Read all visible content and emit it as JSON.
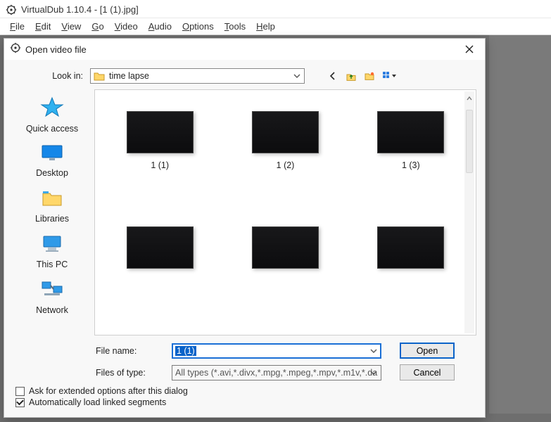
{
  "app": {
    "title": "VirtualDub 1.10.4 - [1 (1).jpg]"
  },
  "menubar": {
    "items": [
      {
        "label": "File",
        "accel": "F"
      },
      {
        "label": "Edit",
        "accel": "E"
      },
      {
        "label": "View",
        "accel": "V"
      },
      {
        "label": "Go",
        "accel": "G"
      },
      {
        "label": "Video",
        "accel": "V"
      },
      {
        "label": "Audio",
        "accel": "A"
      },
      {
        "label": "Options",
        "accel": "O"
      },
      {
        "label": "Tools",
        "accel": "T"
      },
      {
        "label": "Help",
        "accel": "H"
      }
    ]
  },
  "dialog": {
    "title": "Open video file",
    "lookin_label": "Look in:",
    "lookin_value": "time lapse",
    "places": [
      {
        "label": "Quick access"
      },
      {
        "label": "Desktop"
      },
      {
        "label": "Libraries"
      },
      {
        "label": "This PC"
      },
      {
        "label": "Network"
      }
    ],
    "files": [
      {
        "name": "1 (1)"
      },
      {
        "name": "1 (2)"
      },
      {
        "name": "1 (3)"
      },
      {
        "name": ""
      },
      {
        "name": ""
      },
      {
        "name": ""
      }
    ],
    "filename_label": "File name:",
    "filename_value": "1 (1)",
    "filetype_label": "Files of type:",
    "filetype_value": "All types (*.avi,*.divx,*.mpg,*.mpeg,*.mpv,*.m1v,*.da",
    "open_label": "Open",
    "cancel_label": "Cancel",
    "chk_extended": "Ask for extended options after this dialog",
    "chk_autoload": "Automatically load linked segments"
  }
}
